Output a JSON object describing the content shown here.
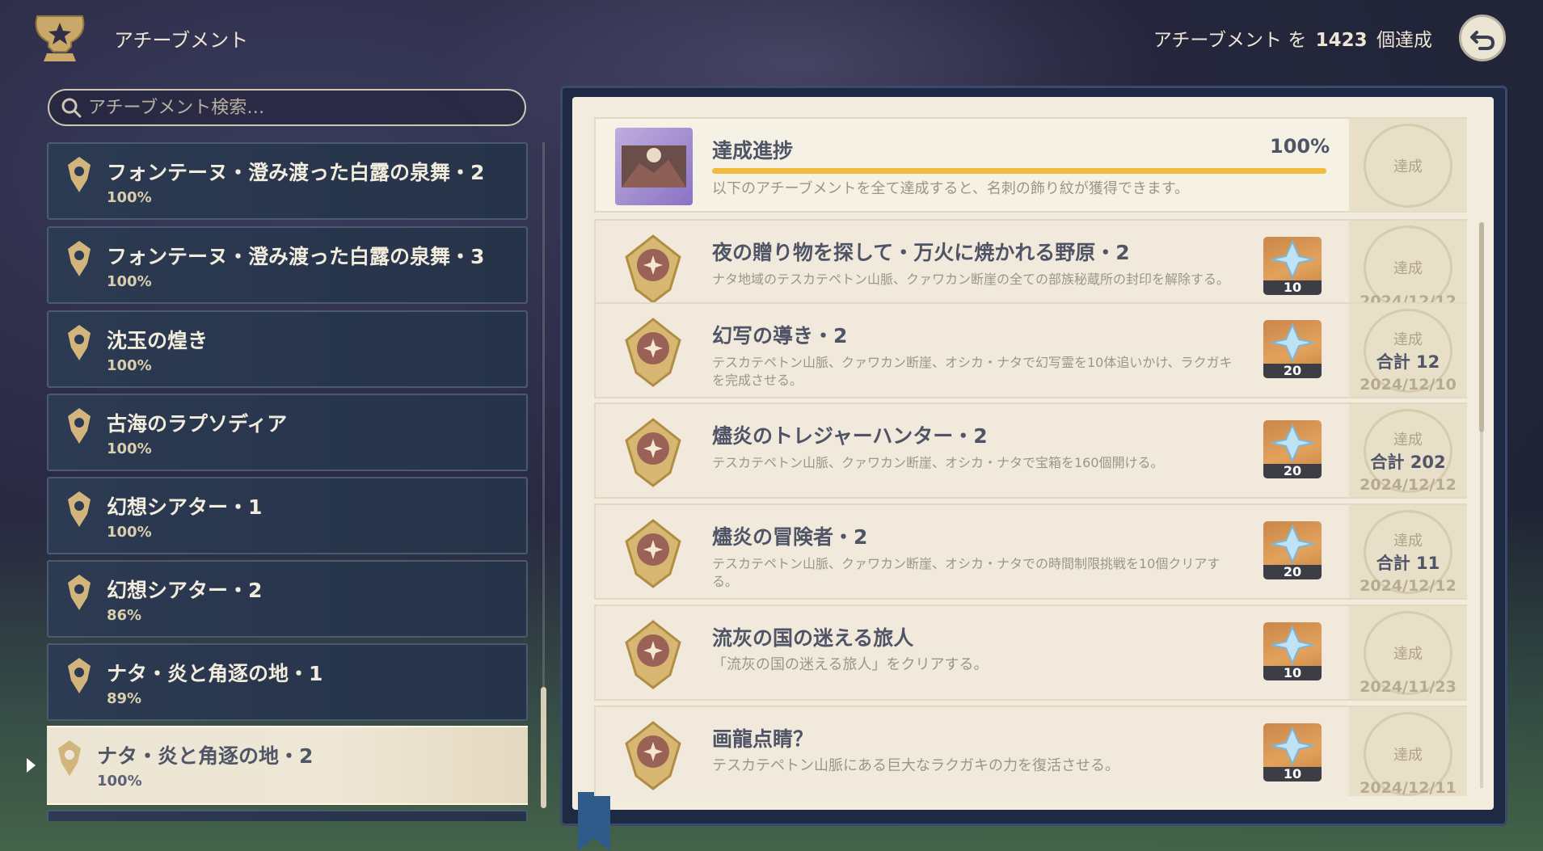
{
  "header": {
    "title": "アチーブメント",
    "count_prefix": "アチーブメント を",
    "count_value": "1423",
    "count_suffix": "個達成"
  },
  "search": {
    "placeholder": "アチーブメント検索…"
  },
  "categories": [
    {
      "name": "フォンテーヌ・澄み渡った白露の泉舞・2",
      "percent": "100%"
    },
    {
      "name": "フォンテーヌ・澄み渡った白露の泉舞・3",
      "percent": "100%"
    },
    {
      "name": "沈玉の煌き",
      "percent": "100%"
    },
    {
      "name": "古海のラプソディア",
      "percent": "100%"
    },
    {
      "name": "幻想シアター・1",
      "percent": "100%"
    },
    {
      "name": "幻想シアター・2",
      "percent": "86%"
    },
    {
      "name": "ナタ・炎と角逐の地・1",
      "percent": "89%"
    },
    {
      "name": "ナタ・炎と角逐の地・2",
      "percent": "100%",
      "selected": true
    }
  ],
  "progress": {
    "title": "達成進捗",
    "percent": "100%",
    "fill": 1.0,
    "description": "以下のアチーブメントを全て達成すると、名刺の飾り紋が獲得できます。",
    "seal_label": "達成"
  },
  "achievements": [
    {
      "title": "夜の贈り物を探して・万火に焼かれる野原・2",
      "description": "ナタ地域のテスカテペトン山脈、クァワカン断崖の全ての部族秘蔵所の封印を解除する。",
      "reward": "10",
      "status": "達成",
      "total": "",
      "date": "2024/12/12"
    },
    {
      "title": "幻写の導き・2",
      "description": "テスカテペトン山脈、クァワカン断崖、オシカ・ナタで幻写霊を10体追いかけ、ラクガキを完成させる。",
      "reward": "20",
      "status": "達成",
      "total": "合計 12",
      "date": "2024/12/10"
    },
    {
      "title": "燼炎のトレジャーハンター・2",
      "description": "テスカテペトン山脈、クァワカン断崖、オシカ・ナタで宝箱を160個開ける。",
      "reward": "20",
      "status": "達成",
      "total": "合計 202",
      "date": "2024/12/12"
    },
    {
      "title": "燼炎の冒険者・2",
      "description": "テスカテペトン山脈、クァワカン断崖、オシカ・ナタでの時間制限挑戦を10個クリアする。",
      "reward": "20",
      "status": "達成",
      "total": "合計 11",
      "date": "2024/12/12"
    },
    {
      "title": "流灰の国の迷える旅人",
      "description": "「流灰の国の迷える旅人」をクリアする。",
      "reward": "10",
      "status": "達成",
      "total": "",
      "date": "2024/11/23"
    },
    {
      "title": "画龍点睛？",
      "description": "テスカテペトン山脈にある巨大なラクガキの力を復活させる。",
      "reward": "10",
      "status": "達成",
      "total": "",
      "date": "2024/12/11"
    }
  ],
  "colors": {
    "accent": "#f2bb3e",
    "panel": "#f2ecdf",
    "list_bg": "#2c3a52"
  },
  "icons": [
    "trophy-icon",
    "back-icon",
    "search-icon",
    "category-emblem-icon",
    "achievement-medal-icon",
    "primogem-icon"
  ]
}
